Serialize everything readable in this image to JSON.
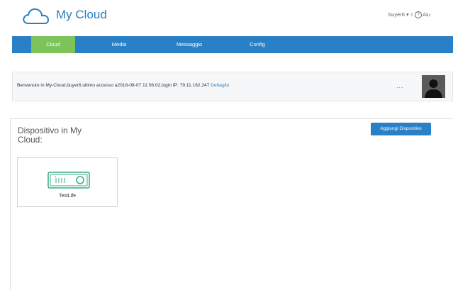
{
  "header": {
    "brand": "My Cloud",
    "username": "buyer6",
    "user_menu_caret": "▾",
    "separator": "I",
    "help_glyph": "?",
    "help_label": "Aiu",
    "logo_icon": "cloud-icon"
  },
  "nav": {
    "items": [
      {
        "label": "Cloud",
        "active": true
      },
      {
        "label": "Media",
        "active": false
      },
      {
        "label": "Messaggio",
        "active": false
      },
      {
        "label": "Config",
        "active": false
      }
    ]
  },
  "welcome": {
    "text": "Benvenuto in My-Cloud,buyer6,ultimo accesso a2018-08-07 11:56:02,login IP:  79.11.162.247 ",
    "link": "Dettaglio",
    "more": "...",
    "avatar_icon": "user-silhouette-icon"
  },
  "devices": {
    "title": "Dispositivo in My Cloud:",
    "add_button": "Aggiungi Dispositivo",
    "items": [
      {
        "name": "TestLife",
        "icon": "router-icon"
      }
    ]
  },
  "colors": {
    "primary": "#2a80c6",
    "active_tab": "#7cc45a",
    "device_icon": "#3aa886"
  }
}
